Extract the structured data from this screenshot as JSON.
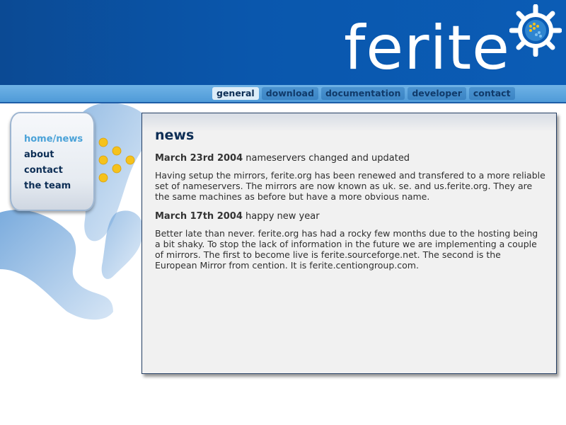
{
  "site": {
    "logo_text": "ferite",
    "logo_icon": "ship-wheel-icon"
  },
  "nav": {
    "tabs": [
      {
        "label": "general",
        "active": true
      },
      {
        "label": "download",
        "active": false
      },
      {
        "label": "documentation",
        "active": false
      },
      {
        "label": "developer",
        "active": false
      },
      {
        "label": "contact",
        "active": false
      }
    ]
  },
  "sidebar": {
    "items": [
      {
        "label": "home/news",
        "active": true
      },
      {
        "label": "about",
        "active": false
      },
      {
        "label": "contact",
        "active": false
      },
      {
        "label": "the team",
        "active": false
      }
    ]
  },
  "main": {
    "title": "news",
    "articles": [
      {
        "date": "March 23rd 2004",
        "headline": "nameservers changed and updated",
        "body": "Having setup the mirrors, ferite.org has been renewed and transfered to a more reliable set of nameservers. The mirrors are now known as uk. se. and us.ferite.org. They are the same machines as before but have a more obvious name."
      },
      {
        "date": "March 17th 2004",
        "headline": "happy new year",
        "body": "Better late than never. ferite.org has had a rocky few months due to the hosting being a bit shaky. To stop the lack of information in the future we are implementing a couple of mirrors. The first to become live is ferite.sourceforge.net. The second is the European Mirror from cention. It is ferite.centiongroup.com."
      }
    ]
  },
  "colors": {
    "header_blue": "#0a57ad",
    "nav_strip": "#5aa6de",
    "active_link": "#4aa2d8",
    "dark_text": "#0d2e55",
    "dots": "#f5c21c"
  }
}
